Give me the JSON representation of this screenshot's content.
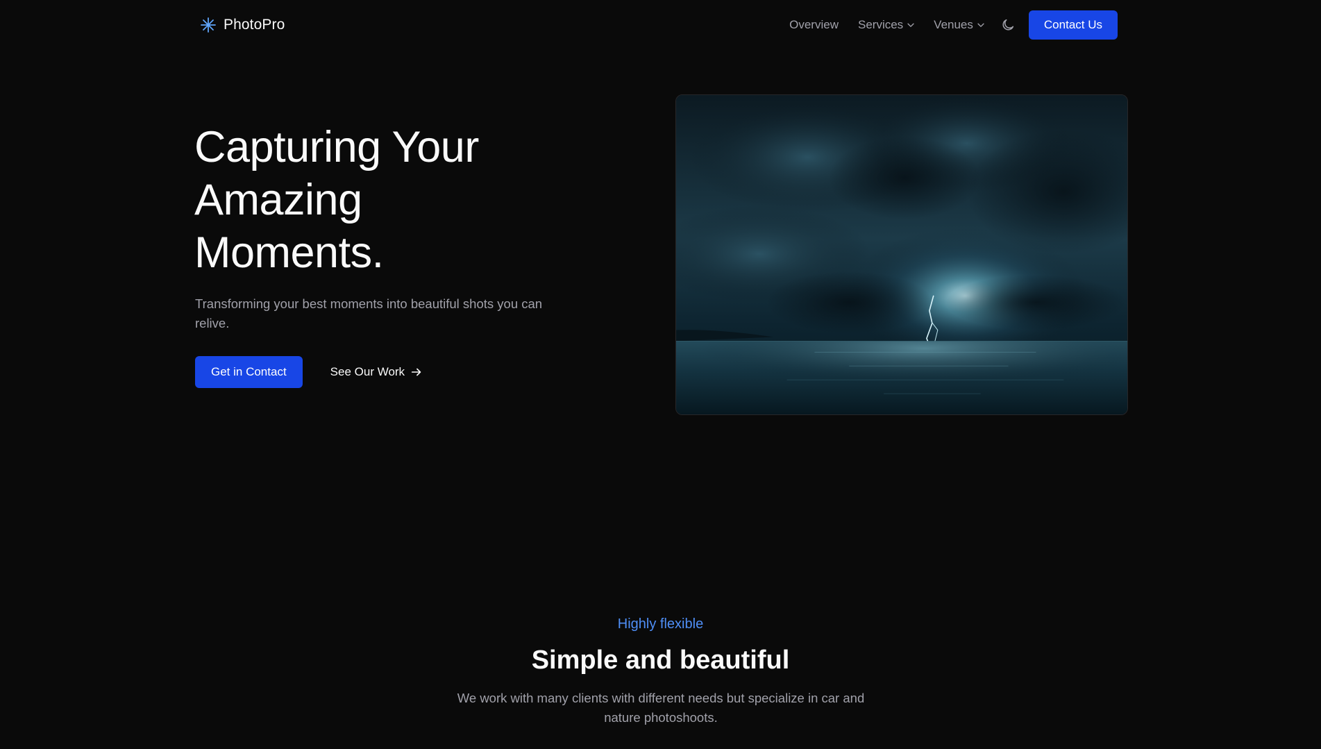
{
  "header": {
    "brand_name": "PhotoPro",
    "brand_icon": "sparkle-icon",
    "nav": {
      "overview": "Overview",
      "services": "Services",
      "venues": "Venues"
    },
    "theme_toggle_icon": "moon-icon",
    "contact_label": "Contact Us"
  },
  "hero": {
    "title_lines": [
      "Capturing Your",
      "Amazing",
      "Moments."
    ],
    "subtitle": "Transforming your best moments into beautiful shots you can relive.",
    "primary_cta": "Get in Contact",
    "secondary_cta": "See Our Work"
  },
  "features": {
    "eyebrow": "Highly flexible",
    "title": "Simple and beautiful",
    "description": "We work with many clients with different needs but specialize in car and nature photoshoots."
  },
  "colors": {
    "background": "#0a0a0a",
    "accent": "#1846e6",
    "eyebrow": "#4f8ff7",
    "muted_text": "#a1a1aa"
  }
}
